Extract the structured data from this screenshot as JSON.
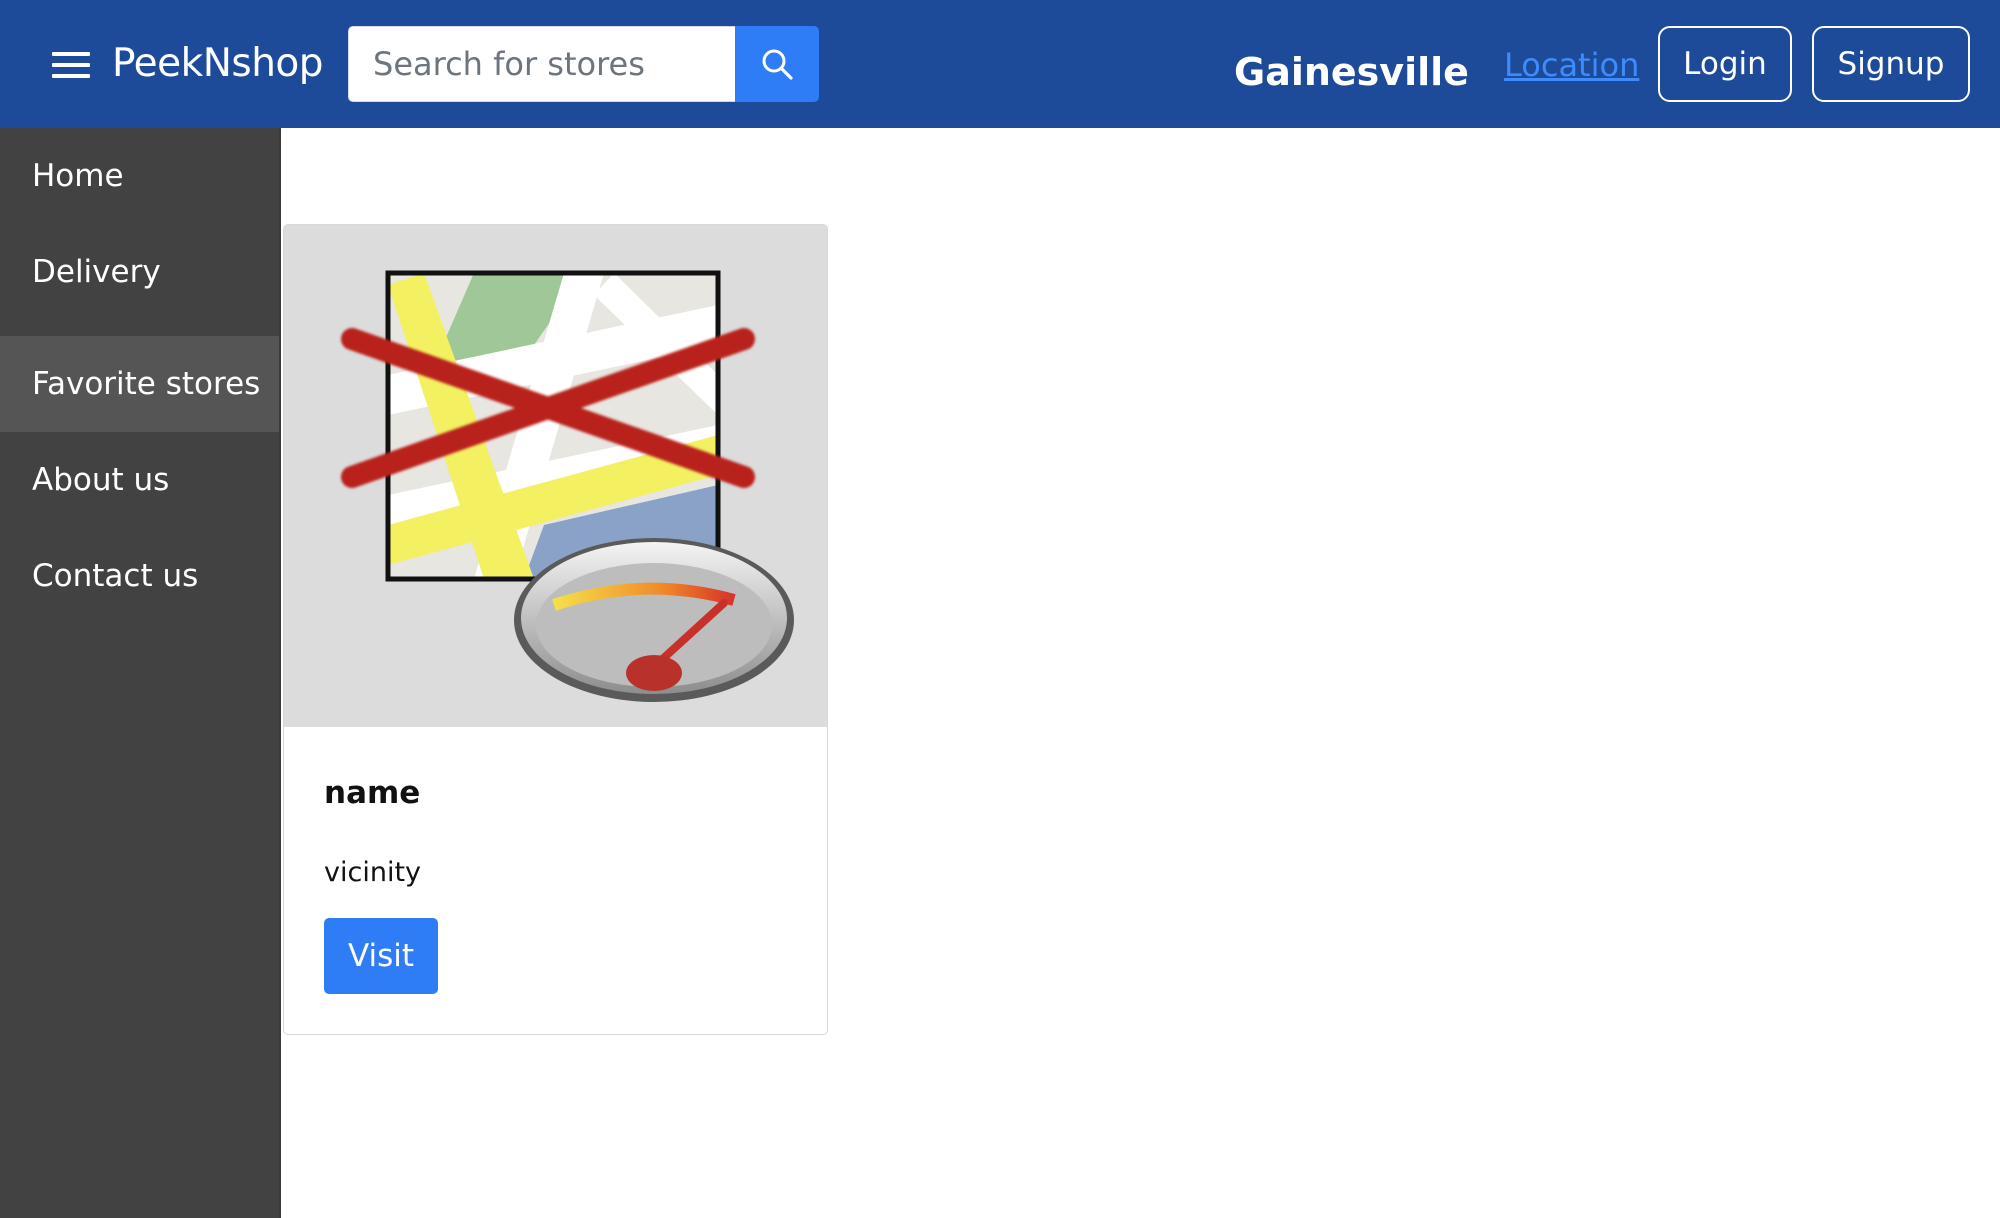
{
  "header": {
    "brand": "PeekNshop",
    "search_placeholder": "Search for stores",
    "city": "Gainesville",
    "location_link": "Location",
    "login_label": "Login",
    "signup_label": "Signup"
  },
  "sidebar": {
    "items": [
      {
        "label": "Home",
        "active": false
      },
      {
        "label": "Delivery",
        "active": false
      },
      {
        "label": "Favorite stores",
        "active": true
      },
      {
        "label": "About us",
        "active": false
      },
      {
        "label": "Contact us",
        "active": false
      }
    ]
  },
  "store_card": {
    "image_icon": "map-unavailable-icon",
    "name": "name",
    "vicinity": "vicinity",
    "visit_label": "Visit"
  },
  "colors": {
    "header_bg": "#1e4b99",
    "sidebar_bg": "#424242",
    "sidebar_active_bg": "#555555",
    "accent": "#2f7df6",
    "link": "#3d8bfd"
  }
}
